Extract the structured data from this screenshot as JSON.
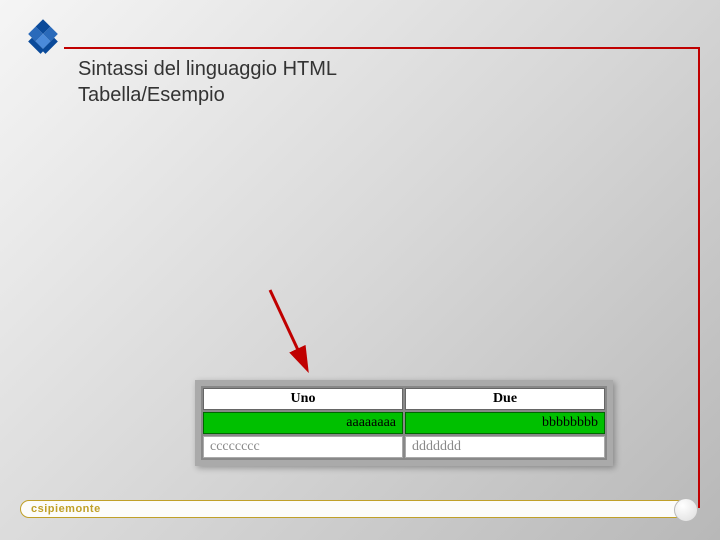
{
  "title_line1": "Sintassi del linguaggio HTML",
  "title_line2": "Tabella/Esempio",
  "table": {
    "headers": [
      "Uno",
      "Due"
    ],
    "row1": [
      "aaaaaaaa",
      "bbbbbbbb"
    ],
    "row2": [
      "cccccccc",
      "ddddddd"
    ]
  },
  "footer_brand": "csipiemonte"
}
